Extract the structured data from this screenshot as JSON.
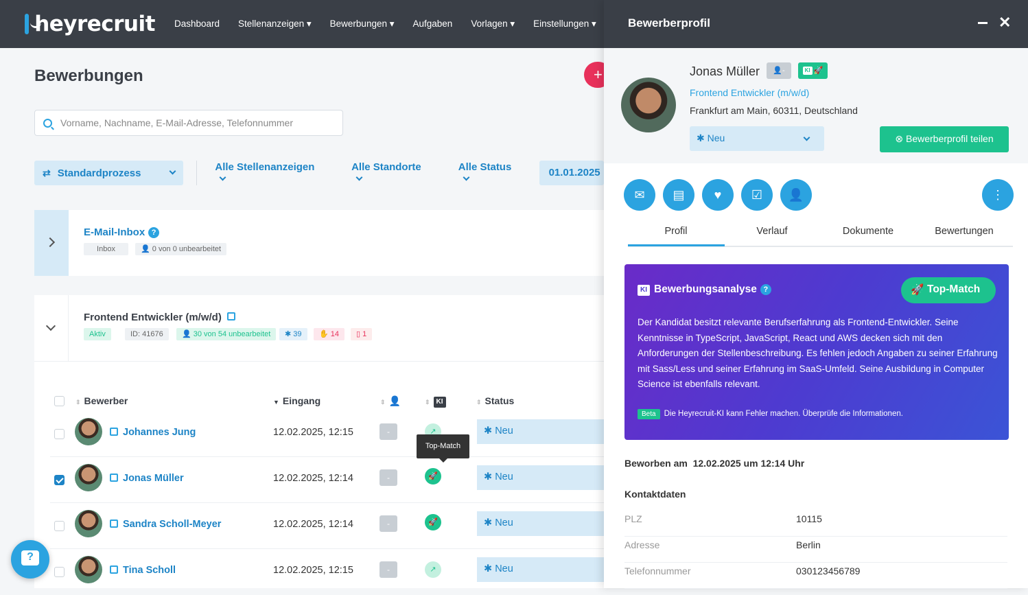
{
  "brand": {
    "name": "heyrecruit"
  },
  "nav": [
    {
      "label": "Dashboard"
    },
    {
      "label": "Stellenanzeigen",
      "dropdown": true
    },
    {
      "label": "Bewerbungen",
      "dropdown": true
    },
    {
      "label": "Aufgaben"
    },
    {
      "label": "Vorlagen",
      "dropdown": true
    },
    {
      "label": "Einstellungen",
      "dropdown": true
    }
  ],
  "page": {
    "title": "Bewerbungen",
    "add_label": "+"
  },
  "search": {
    "placeholder": "Vorname, Nachname, E-Mail-Adresse, Telefonnummer",
    "value": ""
  },
  "filters": {
    "process": "Standardprozess",
    "jobs": "Alle Stellenanzeigen",
    "locations": "Alle Standorte",
    "status": "Alle Status",
    "date": "01.01.2025"
  },
  "inbox": {
    "title": "E-Mail-Inbox",
    "help": "?",
    "tag": "Inbox",
    "unprocessed": "0 von 0 unbearbeitet"
  },
  "job": {
    "title": "Frontend Entwickler (m/w/d)",
    "state": "Aktiv",
    "id": "ID: 41676",
    "unprocessed": "30 von 54 unbearbeitet",
    "new_count": "39",
    "rejected_count": "14",
    "doc_count": "1"
  },
  "table": {
    "headers": {
      "applicant": "Bewerber",
      "received": "Eingang",
      "ai": "KI",
      "status": "Status"
    },
    "rows": [
      {
        "name": "Johannes Jung",
        "date": "12.02.2025, 12:15",
        "assignee": "-",
        "match": "low",
        "status": "Neu",
        "checked": false
      },
      {
        "name": "Jonas Müller",
        "date": "12.02.2025, 12:14",
        "assignee": "-",
        "match": "top",
        "status": "Neu",
        "checked": true
      },
      {
        "name": "Sandra Scholl-Meyer",
        "date": "12.02.2025, 12:14",
        "assignee": "-",
        "match": "top",
        "status": "Neu",
        "checked": false
      },
      {
        "name": "Tina Scholl",
        "date": "12.02.2025, 12:15",
        "assignee": "-",
        "match": "low",
        "status": "Neu",
        "checked": false
      }
    ],
    "tooltip": "Top-Match"
  },
  "chat": {
    "label": "?"
  },
  "panel": {
    "title": "Bewerberprofil",
    "name": "Jonas Müller",
    "assignee_badge": "-",
    "ai_badge": "KI",
    "job": "Frontend Entwickler (m/w/d)",
    "location": "Frankfurt am Main, 60311, Deutschland",
    "status": "Neu",
    "share_label": "Bewerberprofil teilen",
    "tabs": [
      "Profil",
      "Verlauf",
      "Dokumente",
      "Bewertungen"
    ],
    "active_tab": "Profil",
    "analysis": {
      "title": "Bewerbungsanalyse",
      "help": "?",
      "match_label": "Top-Match",
      "text": "Der Kandidat besitzt relevante Berufserfahrung als Frontend-Entwickler. Seine Kenntnisse in TypeScript, JavaScript, React und AWS decken sich mit den Anforderungen der Stellenbeschreibung. Es fehlen jedoch Angaben zu seiner Erfahrung mit Sass/Less und seiner Erfahrung im SaaS-Umfeld. Seine Ausbildung in Computer Science ist ebenfalls relevant.",
      "beta_label": "Beta",
      "disclaimer": "Die Heyrecruit-KI kann Fehler machen. Überprüfe die Informationen."
    },
    "applied_label": "Beworben am",
    "applied_value": "12.02.2025 um 12:14 Uhr",
    "contact_title": "Kontaktdaten",
    "contact": [
      {
        "key": "PLZ",
        "value": "10115"
      },
      {
        "key": "Adresse",
        "value": "Berlin"
      },
      {
        "key": "Telefonnummer",
        "value": "030123456789"
      }
    ]
  },
  "colors": {
    "primary": "#2ba3e0",
    "dark": "#3a3f47",
    "success": "#1dc28e",
    "danger": "#e8315b",
    "ai_gradient": "#6a2bc8"
  }
}
